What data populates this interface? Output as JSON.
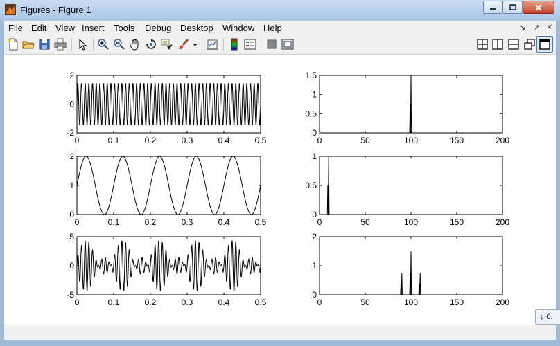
{
  "window": {
    "title": "Figures - Figure 1"
  },
  "menu": {
    "items": [
      "File",
      "Edit",
      "View",
      "Insert",
      "Tools",
      "Debug",
      "Desktop",
      "Window",
      "Help"
    ],
    "right_glyphs": [
      "↘",
      "↗",
      "×"
    ]
  },
  "toolbar": {
    "icons": [
      "new-file",
      "open-folder",
      "save",
      "print",
      "pointer",
      "zoom-in",
      "zoom-out",
      "pan-hand",
      "rotate-3d",
      "data-cursor",
      "brush",
      "brush-dropdown",
      "link-plot",
      "colorbar",
      "legend",
      "hide-plot-tools",
      "show-plot-tools",
      "tile-grid",
      "tile-columns",
      "tile-rows",
      "float",
      "dock"
    ]
  },
  "notice": {
    "text": "0."
  },
  "chart_data": [
    {
      "type": "line",
      "x_range": [
        0,
        0.5
      ],
      "ylim": [
        -2,
        2
      ],
      "xticks": [
        "0",
        "0.1",
        "0.2",
        "0.3",
        "0.4",
        "0.5"
      ],
      "yticks": [
        "-2",
        "0",
        "2"
      ],
      "series": [
        {
          "signal": "sine",
          "amplitude": 1.5,
          "frequency": 100,
          "samples_per_unit": 1000
        }
      ]
    },
    {
      "type": "line",
      "x_range": [
        0,
        200
      ],
      "ylim": [
        0,
        1.5
      ],
      "xticks": [
        "0",
        "50",
        "100",
        "150",
        "200"
      ],
      "yticks": [
        "0",
        "0.5",
        "1",
        "1.5"
      ],
      "spikes": [
        {
          "x": 99,
          "y": 0.75
        },
        {
          "x": 100,
          "y": 1.5
        }
      ]
    },
    {
      "type": "line",
      "x_range": [
        0,
        0.5
      ],
      "ylim": [
        0,
        2
      ],
      "xticks": [
        "0",
        "0.1",
        "0.2",
        "0.3",
        "0.4",
        "0.5"
      ],
      "yticks": [
        "0",
        "1",
        "2"
      ],
      "series": [
        {
          "signal": "sine",
          "offset": 1,
          "amplitude": 1,
          "frequency": 10
        }
      ]
    },
    {
      "type": "line",
      "x_range": [
        0,
        200
      ],
      "ylim": [
        0,
        1
      ],
      "xticks": [
        "0",
        "50",
        "100",
        "150",
        "200"
      ],
      "yticks": [
        "0",
        "0.5",
        "1"
      ],
      "spikes": [
        {
          "x": 9,
          "y": 0.5
        },
        {
          "x": 10,
          "y": 1.0
        }
      ]
    },
    {
      "type": "line",
      "x_range": [
        0,
        0.5
      ],
      "ylim": [
        -5,
        5
      ],
      "xticks": [
        "0",
        "0.1",
        "0.2",
        "0.3",
        "0.4",
        "0.5"
      ],
      "yticks": [
        "-5",
        "0",
        "5"
      ],
      "series": [
        {
          "signal": "am",
          "carrier_frequency": 100,
          "modulation_frequency": 10,
          "modulation_index": 2,
          "amplitude": 1.5,
          "samples_per_unit": 1000
        }
      ]
    },
    {
      "type": "line",
      "x_range": [
        0,
        200
      ],
      "ylim": [
        0,
        2
      ],
      "xticks": [
        "0",
        "50",
        "100",
        "150",
        "200"
      ],
      "yticks": [
        "0",
        "1",
        "2"
      ],
      "spikes": [
        {
          "x": 89,
          "y": 0.38
        },
        {
          "x": 90,
          "y": 0.75
        },
        {
          "x": 99,
          "y": 0.75
        },
        {
          "x": 100,
          "y": 1.5
        },
        {
          "x": 109,
          "y": 0.38
        },
        {
          "x": 110,
          "y": 0.75
        }
      ]
    }
  ]
}
